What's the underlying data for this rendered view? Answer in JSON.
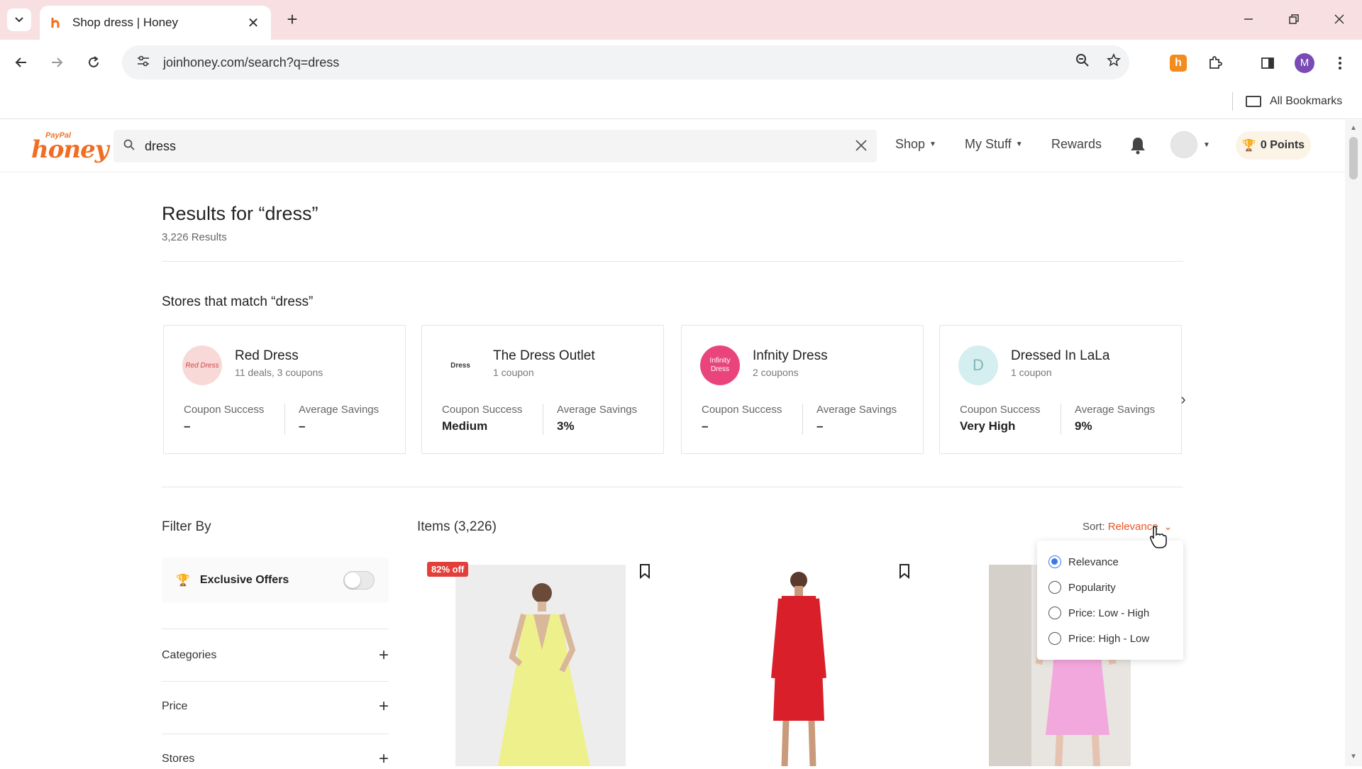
{
  "browser": {
    "tab_title": "Shop dress | Honey",
    "url": "joinhoney.com/search?q=dress",
    "profile_initial": "M",
    "all_bookmarks": "All Bookmarks"
  },
  "header": {
    "logo_small": "PayPal",
    "logo_main": "honey",
    "search_value": "dress",
    "nav_shop": "Shop",
    "nav_mystuff": "My Stuff",
    "nav_rewards": "Rewards",
    "points": "0 Points"
  },
  "results": {
    "title": "Results for “dress”",
    "count": "3,226 Results",
    "stores_title": "Stores that match “dress”"
  },
  "stores": [
    {
      "name": "Red Dress",
      "sub": "11 deals, 3 coupons",
      "logo_text": "Red Dress",
      "success_label": "Coupon Success",
      "success": "–",
      "savings_label": "Average Savings",
      "savings": "–"
    },
    {
      "name": "The Dress Outlet",
      "sub": "1 coupon",
      "logo_text": "Dress",
      "success_label": "Coupon Success",
      "success": "Medium",
      "savings_label": "Average Savings",
      "savings": "3%"
    },
    {
      "name": "Infnity Dress",
      "sub": "2 coupons",
      "logo_text": "Infinity Dress",
      "success_label": "Coupon Success",
      "success": "–",
      "savings_label": "Average Savings",
      "savings": "–"
    },
    {
      "name": "Dressed In LaLa",
      "sub": "1 coupon",
      "logo_text": "D",
      "success_label": "Coupon Success",
      "success": "Very High",
      "savings_label": "Average Savings",
      "savings": "9%"
    }
  ],
  "filters": {
    "title": "Filter By",
    "exclusive": "Exclusive Offers",
    "categories": "Categories",
    "price": "Price",
    "stores": "Stores"
  },
  "items": {
    "title": "Items (3,226)",
    "sort_label": "Sort:",
    "sort_value": "Relevance",
    "badge": "82% off"
  },
  "sort_options": [
    "Relevance",
    "Popularity",
    "Price: Low - High",
    "Price: High - Low"
  ],
  "colors": {
    "accent": "#f26c21",
    "sort_accent": "#e8562a",
    "radio_selected": "#3b78e7",
    "tab_bar": "#f8dfe2"
  }
}
